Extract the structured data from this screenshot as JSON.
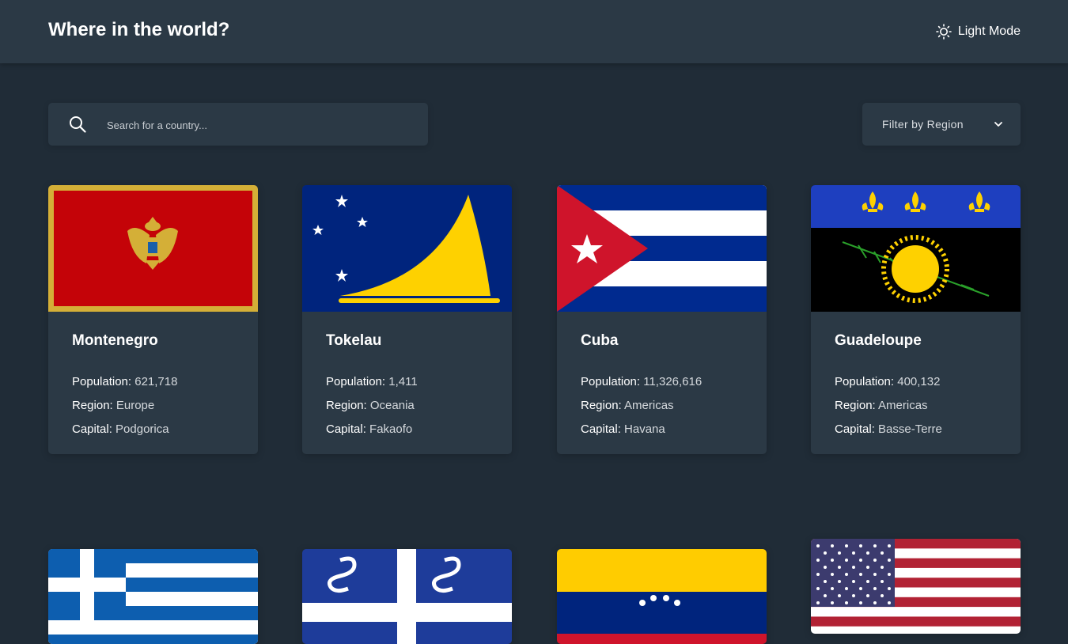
{
  "header": {
    "title": "Where in the world?",
    "mode_toggle": {
      "icon": "sun-icon",
      "label": "Light Mode"
    }
  },
  "search": {
    "icon": "search-icon",
    "placeholder": "Search for a country..."
  },
  "filter": {
    "label": "Filter by Region",
    "icon": "chevron-down-icon"
  },
  "labels": {
    "population": "Population:",
    "region": "Region:",
    "capital": "Capital:"
  },
  "countries": [
    {
      "name": "Montenegro",
      "population": "621,718",
      "region": "Europe",
      "capital": "Podgorica",
      "flag": "montenegro-flag"
    },
    {
      "name": "Tokelau",
      "population": "1,411",
      "region": "Oceania",
      "capital": "Fakaofo",
      "flag": "tokelau-flag"
    },
    {
      "name": "Cuba",
      "population": "11,326,616",
      "region": "Americas",
      "capital": "Havana",
      "flag": "cuba-flag"
    },
    {
      "name": "Guadeloupe",
      "population": "400,132",
      "region": "Americas",
      "capital": "Basse-Terre",
      "flag": "guadeloupe-flag"
    },
    {
      "flag": "greece-flag"
    },
    {
      "flag": "martinique-flag"
    },
    {
      "flag": "venezuela-flag"
    },
    {
      "flag": "united-states-flag"
    }
  ],
  "colors": {
    "background": "#202c37",
    "surface": "#2b3945",
    "text": "#ffffff"
  }
}
